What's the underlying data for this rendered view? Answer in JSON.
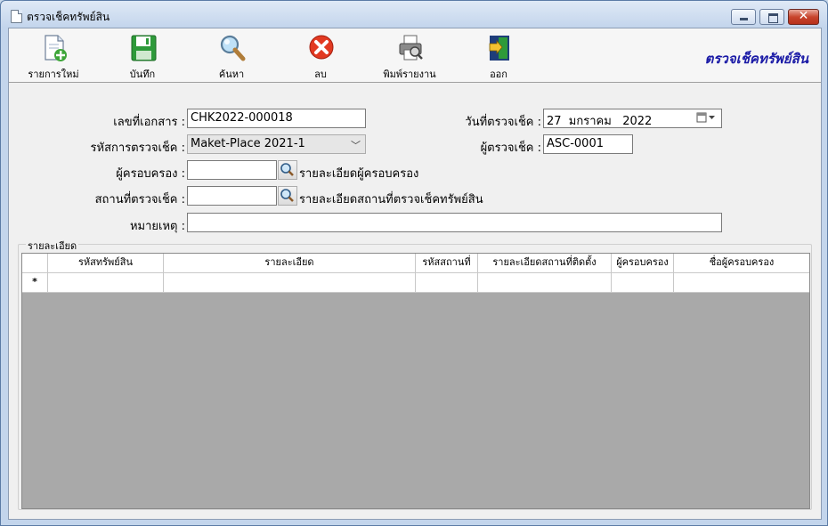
{
  "window": {
    "title": "ตรวจเช็คทรัพย์สิน"
  },
  "toolbar": {
    "items": [
      {
        "label": "รายการใหม่",
        "icon": "new-document-icon"
      },
      {
        "label": "บันทึก",
        "icon": "save-icon"
      },
      {
        "label": "ค้นหา",
        "icon": "search-icon"
      },
      {
        "label": "ลบ",
        "icon": "delete-icon"
      },
      {
        "label": "พิมพ์รายงาน",
        "icon": "print-icon"
      },
      {
        "label": "ออก",
        "icon": "exit-icon"
      }
    ],
    "brand": "ตรวจเช็คทรัพย์สิน"
  },
  "form": {
    "doc_no_label": "เลขที่เอกสาร :",
    "doc_no": "CHK2022-000018",
    "check_code_label": "รหัสการตรวจเช็ค :",
    "check_code": "Maket-Place 2021-1",
    "holder_label": "ผู้ครอบครอง :",
    "holder": "",
    "holder_detail_label": "รายละเอียดผู้ครอบครอง",
    "location_label": "สถานที่ตรวจเช็ค :",
    "location": "",
    "location_detail_label": "รายละเอียดสถานที่ตรวจเช็คทรัพย์สิน",
    "note_label": "หมายเหตุ :",
    "note": "",
    "check_date_label": "วันที่ตรวจเช็ค :",
    "check_date": "27  มกราคม   2022",
    "checker_label": "ผู้ตรวจเช็ค :",
    "checker": "ASC-0001"
  },
  "details": {
    "group_title": "รายละเอียด",
    "columns": [
      "รหัสทรัพย์สิน",
      "รายละเอียด",
      "รหัสสถานที่",
      "รายละเอียดสถานที่ติดตั้ง",
      "ผู้ครอบครอง",
      "ชื่อผู้ครอบครอง"
    ],
    "new_row_marker": "*"
  },
  "colors": {
    "brand_text": "#1a1aa6",
    "grid_empty": "#a9a9a9"
  }
}
